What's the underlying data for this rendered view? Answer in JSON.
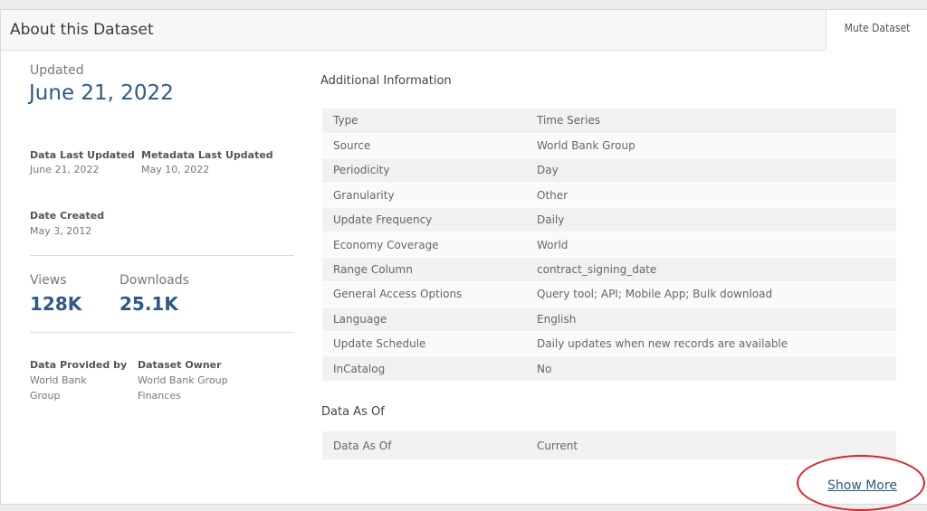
{
  "header": {
    "title": "About this Dataset",
    "mute_label": "Mute Dataset"
  },
  "summary": {
    "updated_label": "Updated",
    "updated_date": "June 21, 2022",
    "data_last_updated_label": "Data Last Updated",
    "data_last_updated_value": "June 21, 2022",
    "metadata_last_updated_label": "Metadata Last Updated",
    "metadata_last_updated_value": "May 10, 2022",
    "date_created_label": "Date Created",
    "date_created_value": "May 3, 2012",
    "views_label": "Views",
    "views_value": "128K",
    "downloads_label": "Downloads",
    "downloads_value": "25.1K",
    "provided_by_label": "Data Provided by",
    "provided_by_value": "World Bank Group",
    "owner_label": "Dataset Owner",
    "owner_value": "World Bank Group Finances"
  },
  "additional_info": {
    "title": "Additional Information",
    "rows": [
      {
        "key": "Type",
        "value": "Time Series"
      },
      {
        "key": "Source",
        "value": "World Bank Group"
      },
      {
        "key": "Periodicity",
        "value": "Day"
      },
      {
        "key": "Granularity",
        "value": "Other"
      },
      {
        "key": "Update Frequency",
        "value": "Daily"
      },
      {
        "key": "Economy Coverage",
        "value": "World"
      },
      {
        "key": "Range Column",
        "value": "contract_signing_date"
      },
      {
        "key": "General Access Options",
        "value": "Query tool; API; Mobile App; Bulk download"
      },
      {
        "key": "Language",
        "value": "English"
      },
      {
        "key": "Update Schedule",
        "value": "Daily updates when new records are available"
      },
      {
        "key": "InCatalog",
        "value": "No"
      }
    ]
  },
  "data_as_of": {
    "title": "Data As Of",
    "key": "Data As Of",
    "value": "Current"
  },
  "footer": {
    "show_more_label": "Show More"
  },
  "colors": {
    "accent": "#2d5a87",
    "highlight": "#d8232a"
  }
}
